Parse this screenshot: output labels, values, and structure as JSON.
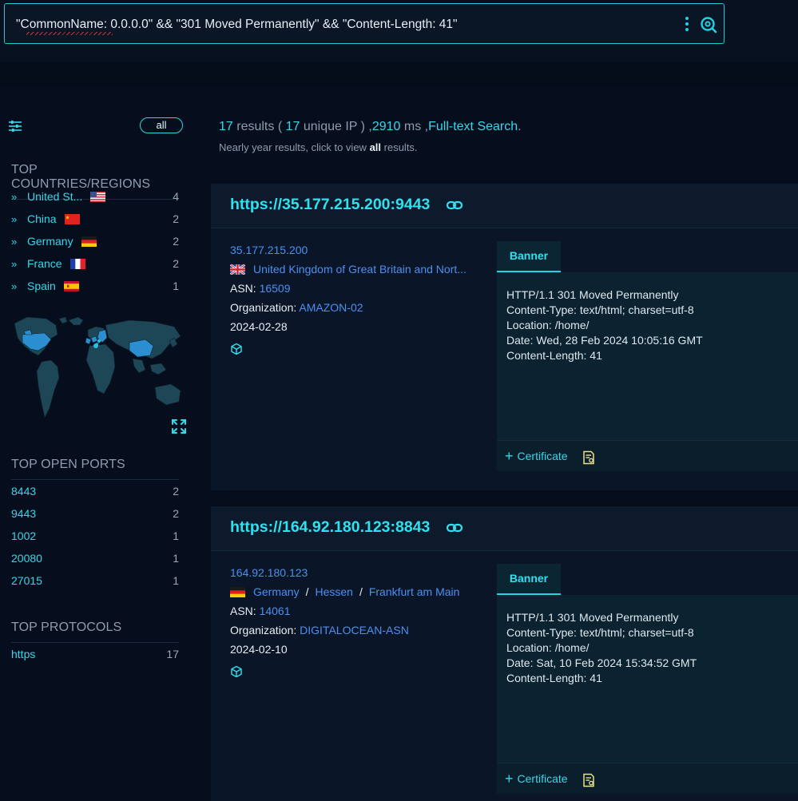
{
  "search": {
    "query": "\"CommonName: 0.0.0.0\" && \"301 Moved Permanently\" && \"Content-Length: 41\"",
    "icons": [
      "more-vertical-icon",
      "search-icon"
    ]
  },
  "colors": {
    "accent": "#2fe0ee",
    "link": "#4c8ff0",
    "background": "#060d1d"
  },
  "sidebar": {
    "all_label": "all",
    "countries_title": "TOP COUNTRIES/REGIONS",
    "countries": [
      {
        "name": "United St...",
        "count": "4",
        "flag": "us"
      },
      {
        "name": "China",
        "count": "2",
        "flag": "cn"
      },
      {
        "name": "Germany",
        "count": "2",
        "flag": "de"
      },
      {
        "name": "France",
        "count": "2",
        "flag": "fr"
      },
      {
        "name": "Spain",
        "count": "1",
        "flag": "es"
      }
    ],
    "ports_title": "TOP OPEN PORTS",
    "ports": [
      {
        "name": "8443",
        "count": "2"
      },
      {
        "name": "9443",
        "count": "2"
      },
      {
        "name": "1002",
        "count": "1"
      },
      {
        "name": "20080",
        "count": "1"
      },
      {
        "name": "27015",
        "count": "1"
      }
    ],
    "protocols_title": "TOP PROTOCOLS",
    "protocols": [
      {
        "name": "https",
        "count": "17"
      }
    ]
  },
  "summary": {
    "results": "17",
    "results_label": " results ( ",
    "unique": "17",
    "unique_label": " unique IP ) ,",
    "ms": "2910",
    "ms_label": " ms ,",
    "fulltext": "Full-text Search",
    "period": ".",
    "sub_pre": "Nearly year results, click to view ",
    "sub_all": "all",
    "sub_post": " results."
  },
  "results": [
    {
      "url": "https://35.177.215.200:9443",
      "ip": "35.177.215.200",
      "flag": "gb",
      "location": [
        "United Kingdom of Great Britain and Nort..."
      ],
      "asn_label": "ASN: ",
      "asn": "16509",
      "org_label": "Organization: ",
      "org": "AMAZON-02",
      "date": "2024-02-28",
      "banner_tab": "Banner",
      "banner": [
        "HTTP/1.1 301 Moved Permanently",
        "Content-Type: text/html; charset=utf-8",
        "Location: /home/",
        "Date: Wed, 28 Feb 2024 10:05:16 GMT",
        "Content-Length: 41"
      ],
      "cert_label": "Certificate"
    },
    {
      "url": "https://164.92.180.123:8843",
      "ip": "164.92.180.123",
      "flag": "de",
      "location": [
        "Germany",
        "Hessen",
        "Frankfurt am Main"
      ],
      "asn_label": "ASN: ",
      "asn": "14061",
      "org_label": "Organization: ",
      "org": "DIGITALOCEAN-ASN",
      "date": "2024-02-10",
      "banner_tab": "Banner",
      "banner": [
        "HTTP/1.1 301 Moved Permanently",
        "Content-Type: text/html; charset=utf-8",
        "Location: /home/",
        "Date: Sat, 10 Feb 2024 15:34:52 GMT",
        "Content-Length: 41"
      ],
      "cert_label": "Certificate"
    }
  ]
}
